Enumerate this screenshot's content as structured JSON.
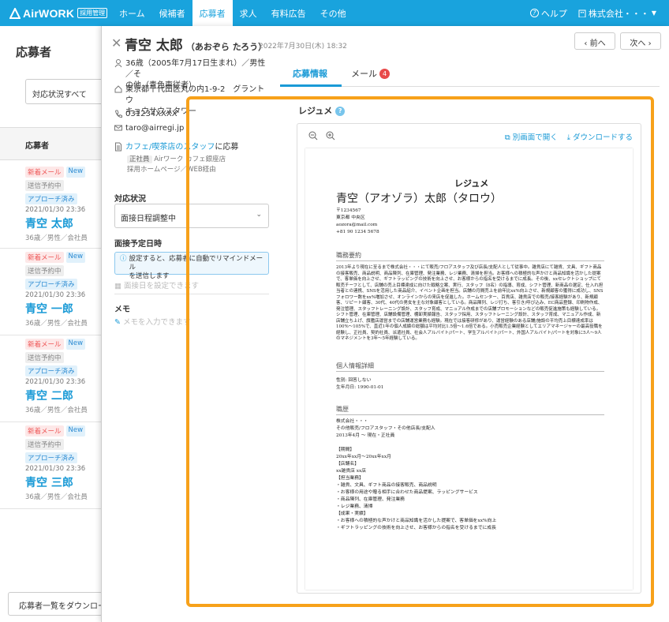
{
  "topbar": {
    "logo": "AirWORK",
    "logo_badge": "採用管理",
    "nav": [
      "ホーム",
      "候補者",
      "応募者",
      "求人",
      "有料広告",
      "その他"
    ],
    "active_nav": 2,
    "help": "ヘルプ",
    "company": "株式会社・・・"
  },
  "left": {
    "title": "応募者",
    "filter": "対応状況すべて",
    "list_header": "応募者",
    "download_button": "応募者一覧をダウンロード",
    "badge_new_mail": "新着メール",
    "badge_new": "New",
    "badge_scheduled": "送信予約中",
    "badge_approach": "アプローチ済み",
    "candidates": [
      {
        "date": "2021/01/30 23:36",
        "name": "青空 太郎",
        "meta": "36歳／男性／会社員"
      },
      {
        "date": "2021/01/30 23:36",
        "name": "青空 一郎",
        "meta": "36歳／男性／会社員"
      },
      {
        "date": "2021/01/30 23:36",
        "name": "青空 二郎",
        "meta": "36歳／男性／会社員"
      },
      {
        "date": "2021/01/30 23:36",
        "name": "青空 三郎",
        "meta": "36歳／男性／会社員"
      }
    ]
  },
  "detail": {
    "name": "青空 太郎",
    "kana": "（あおぞら たろう）",
    "date": "2022年7月30日(木) 18:32",
    "prev": "前へ",
    "next": "次へ",
    "profile_line1": "36歳（2005年7月17日生まれ）／男性／そ",
    "profile_line2": "の他（青色専従者）",
    "address_line1": "東京都千代田区丸の内1-9-2　グラントウ",
    "address_line2": "キョウサウスタワー",
    "phone": "031234XXXX",
    "email": "taro@airregi.jp",
    "job_link": "カフェ/喫茶店のスタッフ",
    "job_suffix": "に応募",
    "job_tag": "正社員",
    "job_store": "Airワーク カフェ銀座店",
    "job_source": "採用ホームページ／WEB経由",
    "status_label": "対応状況",
    "status_value": "面接日程調整中",
    "interview_label": "面接予定日時",
    "interview_notice_1": "設定すると、応募者に自動でリマインドメール",
    "interview_notice_2": "を送信します",
    "interview_placeholder": "面接日を設定できます",
    "memo_label": "メモ",
    "memo_placeholder": "メモを入力できます"
  },
  "tabs": {
    "info": "応募情報",
    "mail": "メール",
    "mail_count": "4"
  },
  "resume": {
    "label": "レジュメ",
    "open_new": "別画面で開く",
    "download": "ダウンロードする",
    "doc_title": "レジュメ",
    "doc_name": "青空（アオゾラ）太郎（タロウ）",
    "doc_contact": "〒1234567\n東京都 中央区\naozora@mail.com\n+81 90 1234 5678",
    "sec_summary": "職務要約",
    "summary": "2013年より現在に至るまで株式会社・・・にて販売/フロアスタッフ及び店長/支配人として従事中。雑貨店にて雑貨、文具、ギフト商品の接客販売、商品説明、商品陳列、在庫管理、発注業務、レジ業務、清掃を担当。お客様への積極的な声かけと商品知識を活かした提案で、客単価を向上させ、ギフトラッピングの技術を向上させ、お客様からの指名を受けるまでに成長。その後、xxセレクトショップにて販売チーフとして、店舗の売上目標達成に向けた戦略立案、実行、スタッフ（8名）の指導、育成、シフト管理、新商品の選定、仕入れ担当者との連携、SNSを活用した商品紹介、イベント企画を担当。店舗の月間売上を前年比xx%向上させ、新規顧客の獲得に成功し、SNSフォロワー数をxx%増加させ、オンラインからの来店を促進した。ホームセンター、百貨店、雑貨店での販売/接客経験があり、新規顧客、リピート顧客、30代、40代の男女を主な対象顧客としている。商品陳列、レジ打ち、客引き/呼び込み、EC商品登録、印刷物作成、発注管理、スタッフトレーニング設計、スタッフ育成、マニュアル作成までの店舗プロモーションなどの販売促進施策も経験している。シフト管理、在庫管理、店舗設備管理、棚卸実績報告、スタッフ採用、スタッフトレーニング設計、スタッフ育成、マニュアル作成、新店舗立ち上げ、旗艦店運営までの店舗運営業務も経験。現在では接客研修があり、運営経験のある店舗/施設の平均売上目標達成率は100%～105%で、直近1年の個人成績の総額は平均対比1.5倍～1.6倍である。小売販売企業経験としてエリアマネージャーの最高役職を経験し、正社員、契約社員、派遣社員、社会人アルバイト/パート、学生アルバイト/パート、外国人アルバイト/パートを対象に5人～9人のマネジメントを3年～5年経験している。",
    "sec_personal": "個人情報詳細",
    "personal": "性別: 回答しない\n生年月日: 1990-01-01",
    "sec_career": "職歴",
    "career": "株式会社・・・\nその他販売/フロアスタッフ・その他店長/支配人\n2013年4月 ～ 現在・正社員\n\n【期間】\n20xx年xx月～20xx年xx月\n【店舗名】\nxx雑貨店 xx店\n【担当業務】\n・雑貨、文具、ギフト商品の接客販売、商品説明\n・お客様の用途や贈る相手に合わせた商品提案、ラッピングサービス\n・商品陳列、在庫管理、発注業務\n・レジ業務、清掃\n【成果・実績】\n・お客様への積極的な声かけと商品知識を活かした提案で、客単価をxx%向上\n・ギフトラッピングの技術を向上させ、お客様からの指名を受けるまでに成長"
  }
}
